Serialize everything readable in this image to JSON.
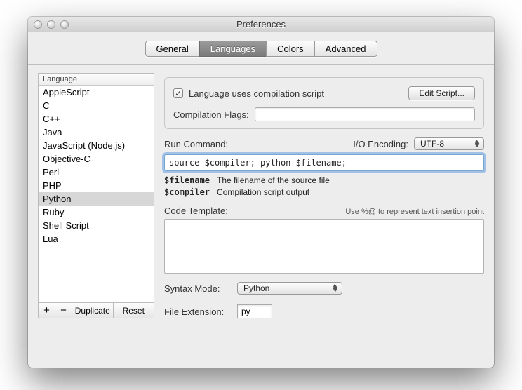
{
  "window": {
    "title": "Preferences"
  },
  "tabs": [
    "General",
    "Languages",
    "Colors",
    "Advanced"
  ],
  "activeTab": "Languages",
  "sidebar": {
    "header": "Language",
    "items": [
      "AppleScript",
      "C",
      "C++",
      "Java",
      "JavaScript (Node.js)",
      "Objective-C",
      "Perl",
      "PHP",
      "Python",
      "Ruby",
      "Shell Script",
      "Lua"
    ],
    "selected": "Python",
    "buttons": {
      "add": "+",
      "remove": "−",
      "duplicate": "Duplicate",
      "reset": "Reset"
    }
  },
  "compile": {
    "checkbox_label": "Language uses compilation script",
    "checked": true,
    "editScript": "Edit Script...",
    "flagsLabel": "Compilation Flags:",
    "flagsValue": ""
  },
  "run": {
    "label": "Run Command:",
    "encodingLabel": "I/O Encoding:",
    "encodingValue": "UTF-8",
    "command": "source $compiler; python $filename;"
  },
  "vars": {
    "filename": {
      "name": "$filename",
      "desc": "The filename of the source file"
    },
    "compiler": {
      "name": "$compiler",
      "desc": "Compilation script output"
    }
  },
  "template": {
    "label": "Code Template:",
    "hint": "Use %@ to represent text insertion point"
  },
  "syntax": {
    "label": "Syntax Mode:",
    "value": "Python"
  },
  "ext": {
    "label": "File Extension:",
    "value": "py"
  }
}
